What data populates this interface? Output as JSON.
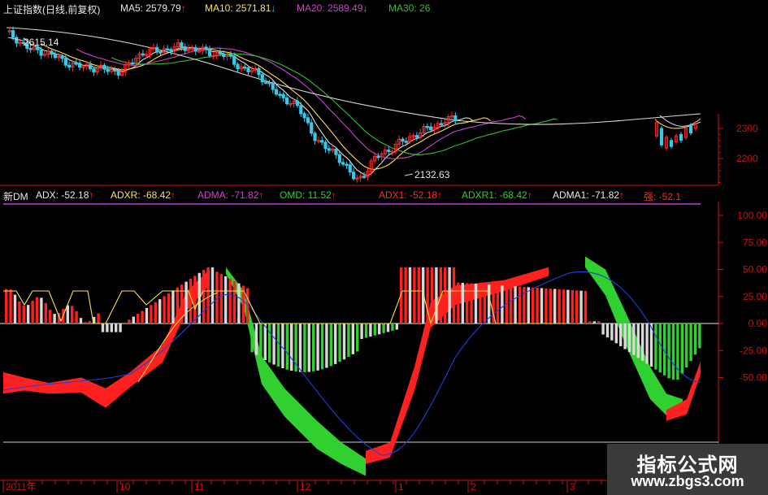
{
  "header": {
    "title": "上证指数(日线,前复权)",
    "ma5": "MA5: 2579.79",
    "ma10": "MA10: 2571.81",
    "ma20": "MA20: 2589.49",
    "ma30": "MA30: 26",
    "up_arrow": "↑",
    "down_arrow": "↓"
  },
  "indicator_header": {
    "name": "新DM",
    "adx": "ADX: -52.18",
    "adxr": "ADXR: -68.42",
    "adma": "ADMA: -71.82",
    "omd": "OMD: 11.52",
    "adx1": "ADX1: -52.18",
    "adxr1": "ADXR1: -68.42",
    "adma1": "ADMA1: -71.82",
    "strong": "强: -52.1",
    "up_arrow": "↑"
  },
  "watermark": {
    "line1": "指标公式网",
    "line2": "www.zbgs3.com"
  },
  "colors": {
    "up": "#ff2a2a",
    "down": "#38c8e8",
    "ma5": "#e0e0e0",
    "ma10": "#ffe24a",
    "ma20": "#d040d0",
    "ma30": "#30c030",
    "axis": "#d01010",
    "osc_red": "#ff2020",
    "osc_white": "#d8d8d8",
    "osc_green": "#30d030",
    "blue": "#2040e0"
  },
  "chart_data": [
    {
      "type": "candlestick",
      "title": "上证指数(日线,前复权)",
      "xlabel": "",
      "ylabel": "",
      "y_ticks": [
        2200,
        2300
      ],
      "y_tick_labels": [
        "2200",
        "2300"
      ],
      "x_tick_labels": [
        "2011年",
        "10",
        "11",
        "12",
        "1",
        "2",
        "3"
      ],
      "annotations": [
        {
          "label": "2615.14",
          "value": 2615.14
        },
        {
          "label": "2132.63",
          "value": 2132.63
        }
      ],
      "series": [
        {
          "name": "MA5",
          "last": 2579.79
        },
        {
          "name": "MA10",
          "last": 2571.81
        },
        {
          "name": "MA20",
          "last": 2589.49
        },
        {
          "name": "MA30",
          "last": 26
        }
      ]
    },
    {
      "type": "bar",
      "title": "新DM",
      "y_ticks": [
        100,
        75,
        50,
        25,
        0,
        -25,
        -50
      ],
      "y_tick_labels": [
        "100.00",
        "75.00",
        "50.00",
        "25.00",
        "0.00",
        "-25.00",
        "-50.00"
      ],
      "ylim": [
        -90,
        120
      ],
      "series": [
        {
          "name": "ADX",
          "last": -52.18
        },
        {
          "name": "ADXR",
          "last": -68.42
        },
        {
          "name": "ADMA",
          "last": -71.82
        },
        {
          "name": "OMD",
          "last": 11.52
        },
        {
          "name": "ADX1",
          "last": -52.18
        },
        {
          "name": "ADXR1",
          "last": -68.42
        },
        {
          "name": "ADMA1",
          "last": -71.82
        },
        {
          "name": "强",
          "last": -52.1
        }
      ]
    }
  ]
}
